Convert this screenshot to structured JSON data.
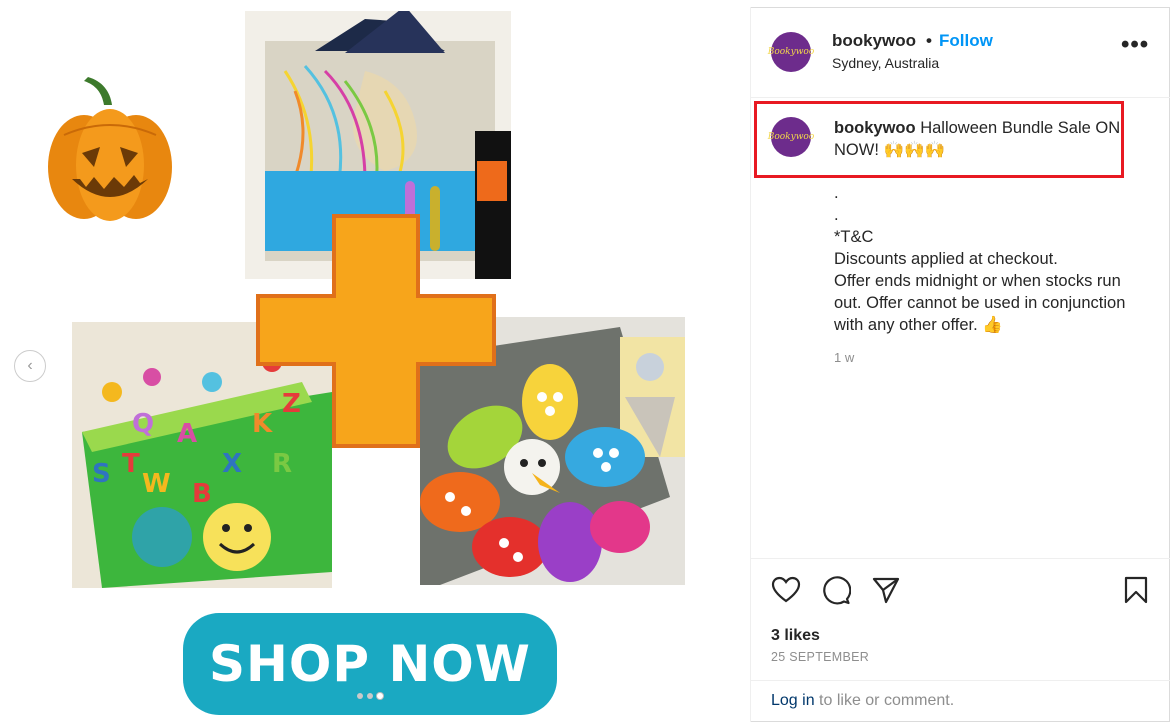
{
  "post": {
    "username": "bookywoo",
    "separator": "•",
    "follow_label": "Follow",
    "location": "Sydney, Australia",
    "more_label": "•••",
    "avatar_text": "Bookywoo"
  },
  "caption": {
    "username": "bookywoo",
    "text": "Halloween Bundle Sale ON NOW! 🙌🙌🙌",
    "lines": [
      ".",
      ".",
      "*T&C",
      "Discounts applied at checkout.",
      "Offer ends midnight or when stocks run out. Offer cannot be used in conjunction with any other offer. 👍"
    ],
    "time": "1 w"
  },
  "actions": {
    "likes": "3 likes",
    "date": "25 SEPTEMBER",
    "login_link": "Log in",
    "login_rest": " to like or comment."
  },
  "media": {
    "shop_now": "SHOP NOW",
    "prev_arrow": "‹",
    "slide_count": 3,
    "active_slide": 3,
    "tile_letters": [
      "S",
      "T",
      "W",
      "A",
      "B",
      "X",
      "K",
      "R",
      "Q",
      "Z"
    ]
  },
  "colors": {
    "follow": "#0095f6",
    "highlight": "#e81922",
    "shop_button": "#1aa9c2",
    "plus": "#f5a31a",
    "avatar": "#6d2c8c"
  }
}
